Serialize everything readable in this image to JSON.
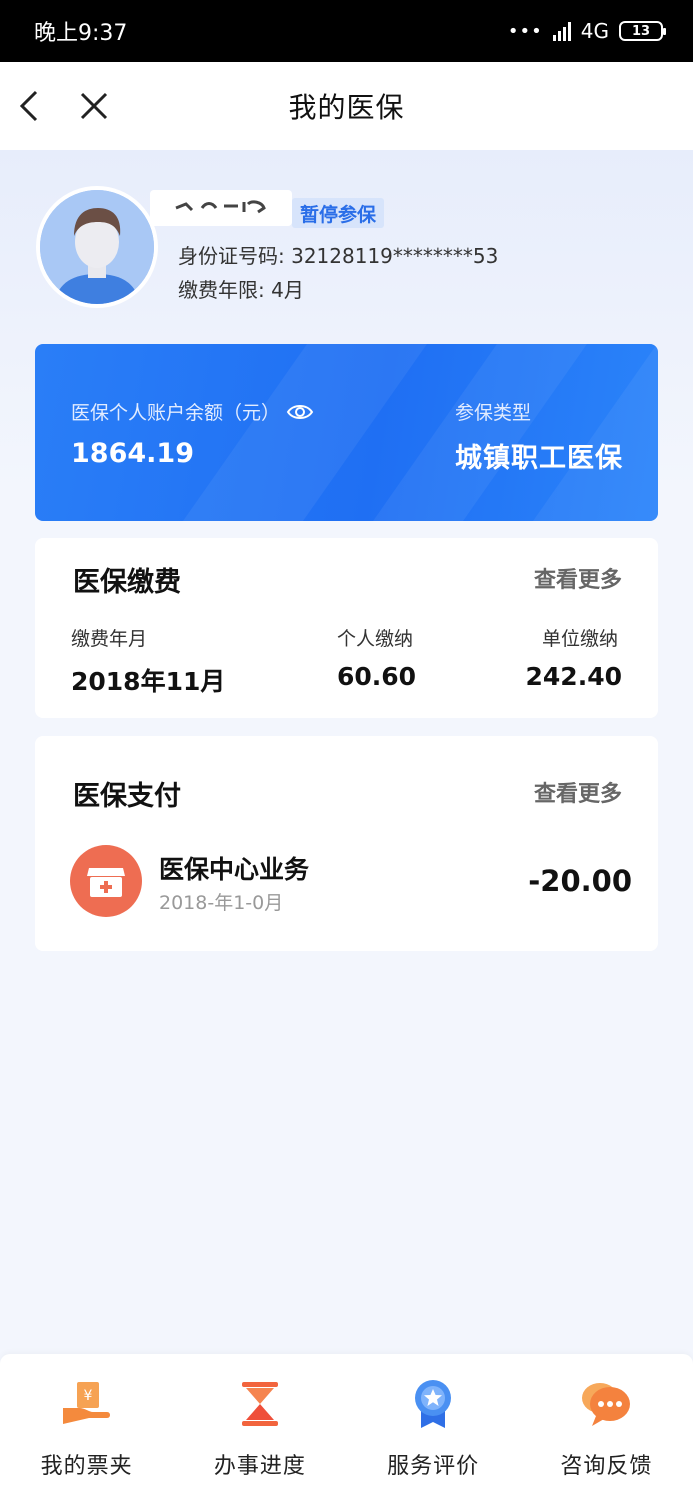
{
  "status_bar": {
    "time": "晚上9:37",
    "network": "4G",
    "battery": "13"
  },
  "nav": {
    "title": "我的医保"
  },
  "profile": {
    "status_tag": "暂停参保",
    "id_label": "身份证号码",
    "id_value": "32128119********53",
    "years_label": "缴费年限",
    "years_value": "4月"
  },
  "account": {
    "balance_label": "医保个人账户余额（元）",
    "balance_value": "1864.19",
    "type_label": "参保类型",
    "type_value": "城镇职工医保"
  },
  "payments": {
    "title": "医保缴费",
    "more_label": "查看更多",
    "col_month_label": "缴费年月",
    "col_personal_label": "个人缴纳",
    "col_unit_label": "单位缴纳",
    "month_value": "2018年11月",
    "personal_value": "60.60",
    "unit_value": "242.40"
  },
  "spending": {
    "title": "医保支付",
    "more_label": "查看更多",
    "item_name": "医保中心业务",
    "item_date": "2018-年1-0月",
    "item_amount": "-20.00"
  },
  "tabs": [
    {
      "label": "我的票夹",
      "icon": "ticket-wallet-icon"
    },
    {
      "label": "办事进度",
      "icon": "hourglass-icon"
    },
    {
      "label": "服务评价",
      "icon": "medal-icon"
    },
    {
      "label": "咨询反馈",
      "icon": "chat-bubble-icon"
    }
  ],
  "colors": {
    "accent_blue": "#1f6ff3",
    "tag_blue": "#2a6ee8",
    "spend_icon_bg": "#ee6d52",
    "page_bg": "#f3f6fd"
  }
}
